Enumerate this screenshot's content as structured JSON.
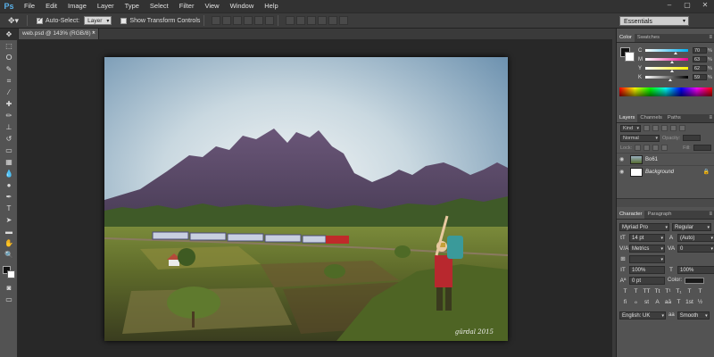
{
  "menu": {
    "logo": "Ps",
    "items": [
      "File",
      "Edit",
      "Image",
      "Layer",
      "Type",
      "Select",
      "Filter",
      "View",
      "Window",
      "Help"
    ],
    "window_controls": [
      "–",
      "▢",
      "✕"
    ]
  },
  "options": {
    "auto_select_label": "Auto-Select:",
    "auto_select_target": "Layer",
    "show_transform_label": "Show Transform Controls",
    "workspace": "Essentials"
  },
  "document": {
    "tab_title": "web.psd @ 143% (RGB/8) *",
    "signature": "gürdal 2015"
  },
  "color_panel": {
    "tabs": [
      "Color",
      "Swatches"
    ],
    "sliders": [
      {
        "label": "C",
        "value": "70",
        "level": 0.7
      },
      {
        "label": "M",
        "value": "63",
        "level": 0.63
      },
      {
        "label": "Y",
        "value": "62",
        "level": 0.62
      },
      {
        "label": "K",
        "value": "59",
        "level": 0.59
      }
    ],
    "pct": "%"
  },
  "layers_panel": {
    "tabs": [
      "Layers",
      "Channels",
      "Paths"
    ],
    "filter_kind": "Kind",
    "blend_mode": "Normal",
    "opacity_label": "Opacity:",
    "lock_label": "Lock:",
    "fill_label": "Fill:",
    "layers": [
      {
        "name": "Βο61",
        "italic": false
      },
      {
        "name": "Background",
        "italic": true
      }
    ]
  },
  "character_panel": {
    "tabs": [
      "Character",
      "Paragraph"
    ],
    "font_family": "Myriad Pro",
    "font_style": "Regular",
    "font_size": "14 pt",
    "leading": "(Auto)",
    "kerning": "Metrics",
    "tracking": "0",
    "vscale": "100%",
    "hscale": "100%",
    "baseline": "0 pt",
    "color_label": "Color:",
    "style_buttons": [
      "T",
      "T",
      "TT",
      "Tt",
      "T¹",
      "T₁",
      "T",
      "T"
    ],
    "opentype_buttons": [
      "fi",
      "ℴ",
      "st",
      "A",
      "aā",
      "T",
      "1st",
      "½"
    ],
    "language": "English: UK",
    "antialias": "Smooth",
    "aa_icon": "aa"
  },
  "tools": [
    {
      "icon": "move-icon",
      "glyph": "✥"
    },
    {
      "icon": "marquee-icon",
      "glyph": "⬚"
    },
    {
      "icon": "lasso-icon",
      "glyph": "ⵔ"
    },
    {
      "icon": "quick-select-icon",
      "glyph": "✎"
    },
    {
      "icon": "crop-icon",
      "glyph": "⌗"
    },
    {
      "icon": "eyedropper-icon",
      "glyph": "⁄"
    },
    {
      "icon": "healing-icon",
      "glyph": "✚"
    },
    {
      "icon": "brush-icon",
      "glyph": "✏"
    },
    {
      "icon": "stamp-icon",
      "glyph": "⊥"
    },
    {
      "icon": "history-brush-icon",
      "glyph": "↺"
    },
    {
      "icon": "eraser-icon",
      "glyph": "▭"
    },
    {
      "icon": "gradient-icon",
      "glyph": "▦"
    },
    {
      "icon": "blur-icon",
      "glyph": "💧"
    },
    {
      "icon": "dodge-icon",
      "glyph": "●"
    },
    {
      "icon": "pen-icon",
      "glyph": "✒"
    },
    {
      "icon": "type-icon",
      "glyph": "T"
    },
    {
      "icon": "path-select-icon",
      "glyph": "➤"
    },
    {
      "icon": "shape-icon",
      "glyph": "▬"
    },
    {
      "icon": "hand-icon",
      "glyph": "✋"
    },
    {
      "icon": "zoom-icon",
      "glyph": "🔍"
    }
  ]
}
